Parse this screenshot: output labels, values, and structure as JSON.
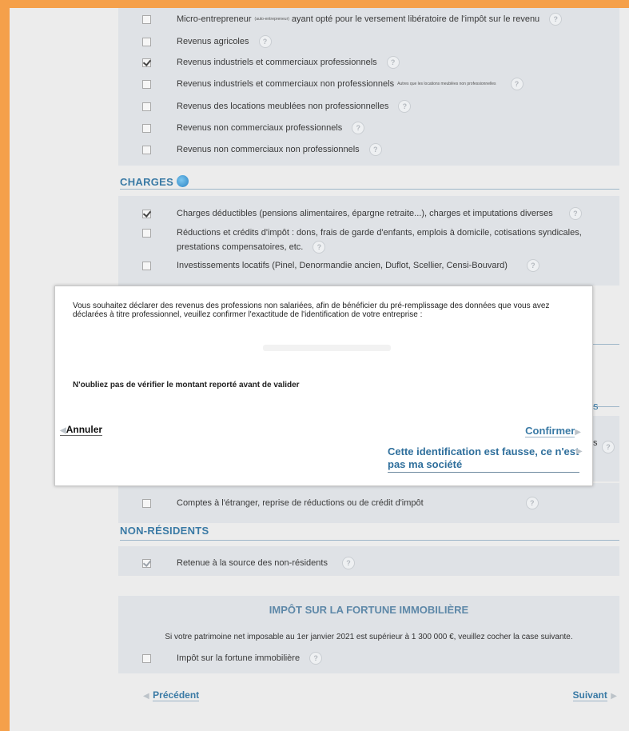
{
  "income": {
    "items": [
      {
        "label": "Micro-entrepreneur",
        "small": "(auto-entrepreneur)",
        "label2": "ayant opté pour le versement libératoire de l'impôt sur le revenu",
        "checked": false
      },
      {
        "label": "Revenus agricoles",
        "checked": false
      },
      {
        "label": "Revenus industriels et commerciaux professionnels",
        "checked": true
      },
      {
        "label": "Revenus industriels et commerciaux non professionnels",
        "small": "Autres que les locations meublées non professionnelles",
        "checked": false
      },
      {
        "label": "Revenus des locations meublées non professionnelles",
        "checked": false
      },
      {
        "label": "Revenus non commerciaux professionnels",
        "checked": false
      },
      {
        "label": "Revenus non commerciaux non professionnels",
        "checked": false
      }
    ]
  },
  "charges": {
    "heading": "CHARGES",
    "items": [
      {
        "label": "Charges déductibles (pensions alimentaires, épargne retraite...), charges et imputations diverses",
        "checked": true
      },
      {
        "label": "Réductions et crédits d'impôt : dons, frais de garde d'enfants, emplois à domicile, cotisations syndicales,",
        "label2": "prestations compensatoires, etc.",
        "checked": false
      },
      {
        "label": "Investissements locatifs (Pinel, Denormandie ancien, Duflot, Scellier, Censi-Bouvard)",
        "checked": false
      }
    ]
  },
  "partial": {
    "hidden_tail": "s",
    "hidden_tail2": "s"
  },
  "foreign": {
    "label": "Comptes à l'étranger, reprise de réductions ou de crédit d'impôt",
    "checked": false
  },
  "nonresidents": {
    "heading": "NON-RÉSIDENTS",
    "item": {
      "label": "Retenue à la source des non-résidents",
      "checked": true
    }
  },
  "ifi": {
    "heading": "IMPÔT SUR LA FORTUNE IMMOBILIÈRE",
    "text": "Si votre patrimoine net imposable au 1er janvier 2021 est supérieur à 1 300 000 €, veuillez cocher la case suivante.",
    "item": {
      "label": "Impôt sur la fortune immobilière",
      "checked": false
    }
  },
  "nav": {
    "prev": "Précédent",
    "next": "Suivant"
  },
  "modal": {
    "message": "Vous souhaitez déclarer des revenus des professions non salariées, afin de bénéficier du pré-remplissage des données que vous avez déclarées à titre professionnel, veuillez confirmer l'exactitude de l'identification de votre entreprise :",
    "warning": "N'oubliez pas de vérifier le montant reporté avant de valider",
    "cancel": "Annuler",
    "confirm": "Confirmer",
    "wrong_id": "Cette identification est fausse, ce n'est pas ma société"
  },
  "colors": {
    "accent": "#3a7aa5",
    "frame": "#f5a04a",
    "panel": "#dfe2e6"
  },
  "icons": {
    "help": "?"
  }
}
